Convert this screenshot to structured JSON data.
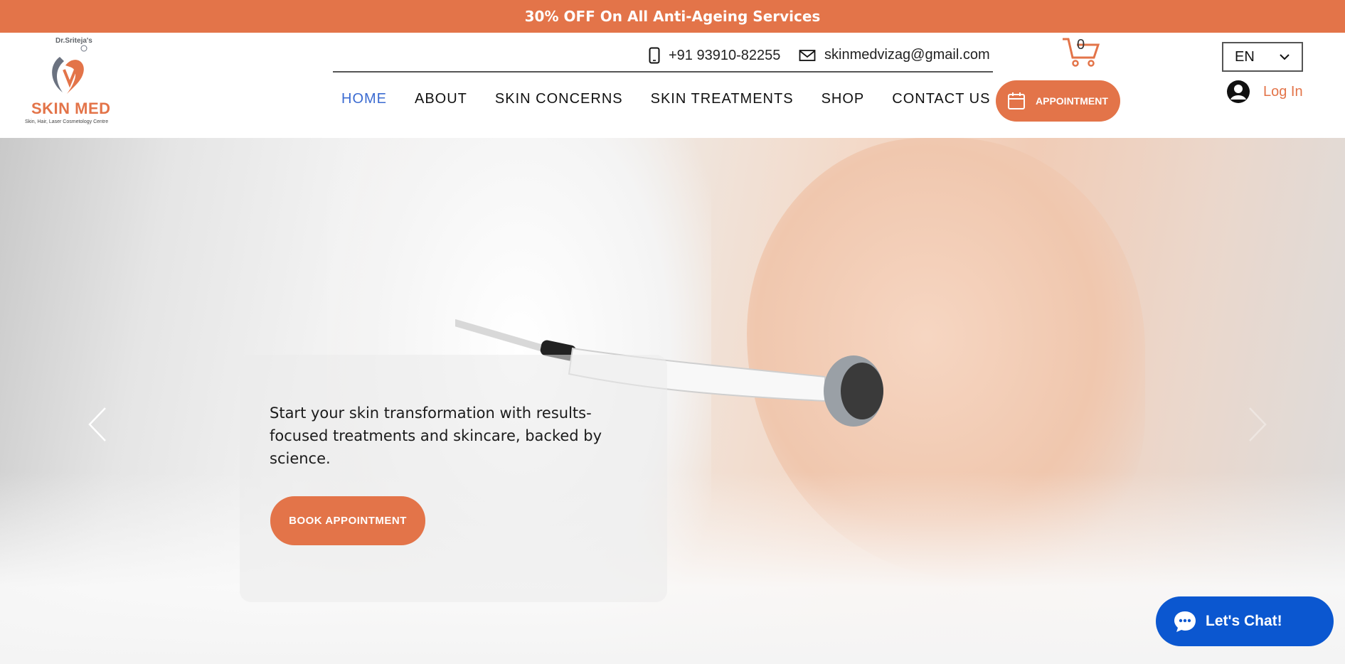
{
  "promo": {
    "text": "30% OFF On All Anti-Ageing Services"
  },
  "logo": {
    "top": "Dr.Sriteja's",
    "name": "SKIN MED",
    "tagline": "Skin, Hair, Laser Cosmetology Centre"
  },
  "contact": {
    "phone": "+91 93910-82255",
    "email": "skinmedvizag@gmail.com"
  },
  "cart": {
    "count": "0"
  },
  "language": {
    "selected": "EN"
  },
  "nav": {
    "items": [
      "HOME",
      "ABOUT",
      "SKIN CONCERNS",
      "SKIN TREATMENTS",
      "SHOP",
      "CONTACT US"
    ],
    "active": "HOME"
  },
  "appointment_button": "APPOINTMENT",
  "login": {
    "label": "Log In"
  },
  "hero": {
    "text": "Start your skin transformation with results-focused treatments and skincare, backed by science.",
    "cta": "BOOK APPOINTMENT"
  },
  "chat": {
    "label": "Let's Chat!"
  },
  "colors": {
    "brand": "#e37449",
    "nav_active": "#3b6bd1",
    "chat": "#0b57d0"
  },
  "icons": [
    "mobile-phone-icon",
    "mail-icon",
    "cart-icon",
    "chevron-down-icon",
    "calendar-icon",
    "user-avatar-icon",
    "chevron-left-icon",
    "chevron-right-icon",
    "chat-bubble-icon"
  ]
}
